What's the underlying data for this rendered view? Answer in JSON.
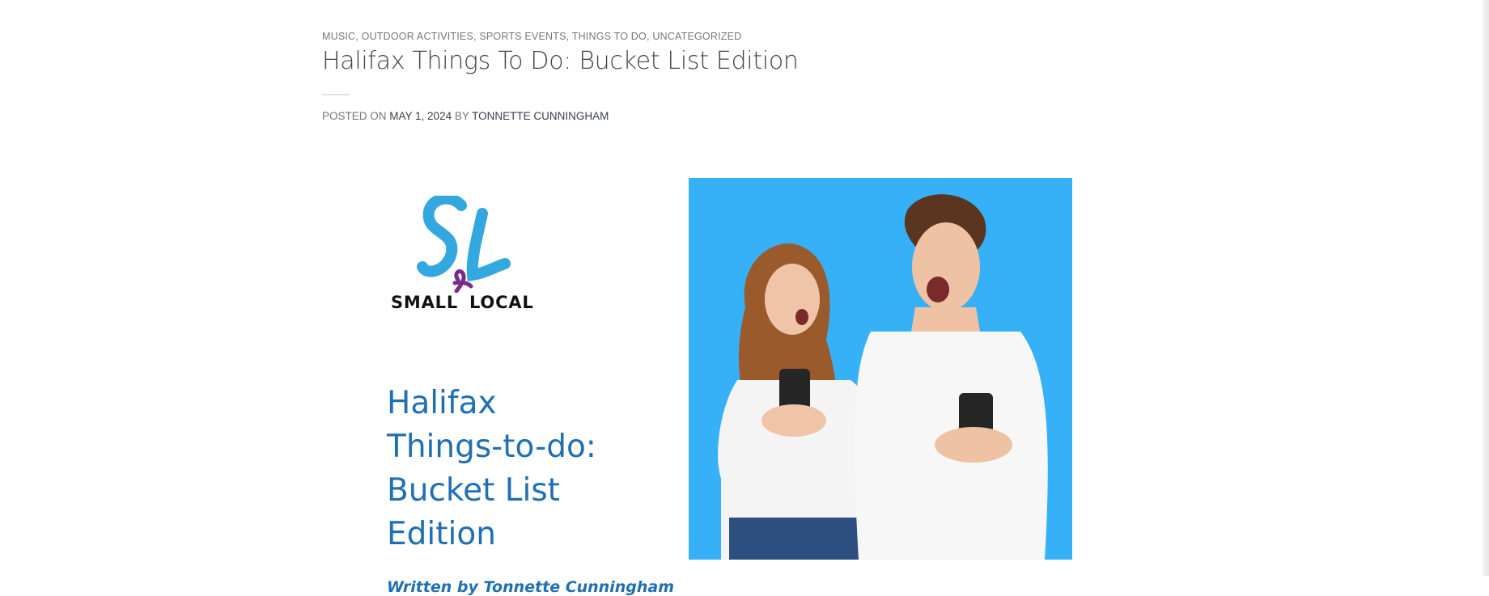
{
  "post": {
    "categories": [
      "MUSIC",
      "OUTDOOR ACTIVITIES",
      "SPORTS EVENTS",
      "THINGS TO DO",
      "UNCATEGORIZED"
    ],
    "title": "Halifax Things To Do: Bucket List Edition",
    "meta": {
      "posted_on_label": "POSTED ON",
      "date": "MAY 1, 2024",
      "by_label": "BY",
      "author": "TONNETTE CUNNINGHAM"
    }
  },
  "featured_image": {
    "logo": {
      "letters": "SL",
      "ampersand": "&",
      "word_left": "SMALL",
      "word_right": "LOCAL"
    },
    "heading_lines": [
      "Halifax",
      "Things-to-do:",
      "Bucket List",
      "Edition"
    ],
    "byline": "Written by Tonnette Cunningham",
    "photo_background": "#36b1f8"
  },
  "colors": {
    "accent_blue": "#1f6fb5",
    "logo_blue": "#33a8e0",
    "logo_purple": "#7b2a8c",
    "meta_link": "#38404d"
  }
}
